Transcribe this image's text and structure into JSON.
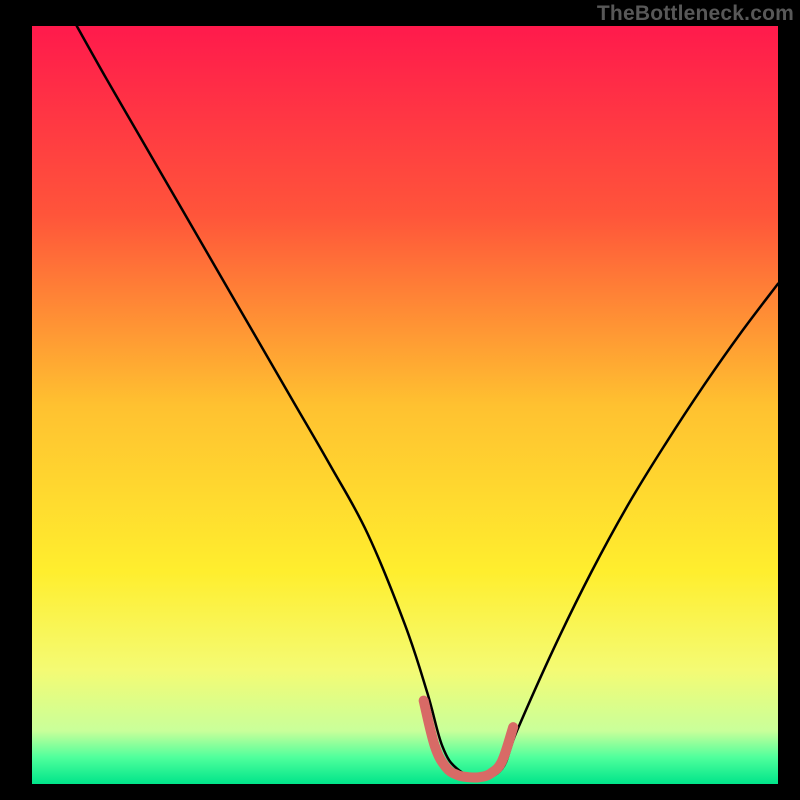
{
  "watermark": "TheBottleneck.com",
  "chart_data": {
    "type": "line",
    "title": "",
    "xlabel": "",
    "ylabel": "",
    "xlim": [
      0,
      100
    ],
    "ylim": [
      0,
      100
    ],
    "grid": false,
    "legend": false,
    "background_gradient": {
      "stops": [
        {
          "offset": 0.0,
          "color": "#ff1a4c"
        },
        {
          "offset": 0.25,
          "color": "#ff553a"
        },
        {
          "offset": 0.5,
          "color": "#ffc130"
        },
        {
          "offset": 0.72,
          "color": "#ffee2e"
        },
        {
          "offset": 0.85,
          "color": "#f4fb74"
        },
        {
          "offset": 0.93,
          "color": "#c9ff9a"
        },
        {
          "offset": 0.965,
          "color": "#4fff9c"
        },
        {
          "offset": 1.0,
          "color": "#00e58a"
        }
      ]
    },
    "series": [
      {
        "name": "curve",
        "stroke": "#000000",
        "stroke_width": 2.5,
        "x": [
          6,
          10,
          15,
          20,
          25,
          30,
          35,
          40,
          45,
          50,
          53,
          55,
          57,
          60,
          63,
          65,
          70,
          75,
          80,
          85,
          90,
          95,
          100
        ],
        "y": [
          100,
          93,
          84.5,
          76,
          67.5,
          59,
          50.5,
          42,
          33,
          21,
          12,
          5,
          2,
          0.8,
          2,
          7,
          18,
          28,
          37,
          45,
          52.5,
          59.5,
          66
        ]
      },
      {
        "name": "valley-marker",
        "stroke": "#d86a66",
        "stroke_width": 10,
        "linecap": "round",
        "x": [
          52.5,
          54,
          55.5,
          57,
          58.5,
          60,
          61.5,
          63,
          64.5
        ],
        "y": [
          11,
          5,
          2.2,
          1.2,
          0.9,
          0.9,
          1.4,
          3,
          7.5
        ]
      }
    ]
  }
}
